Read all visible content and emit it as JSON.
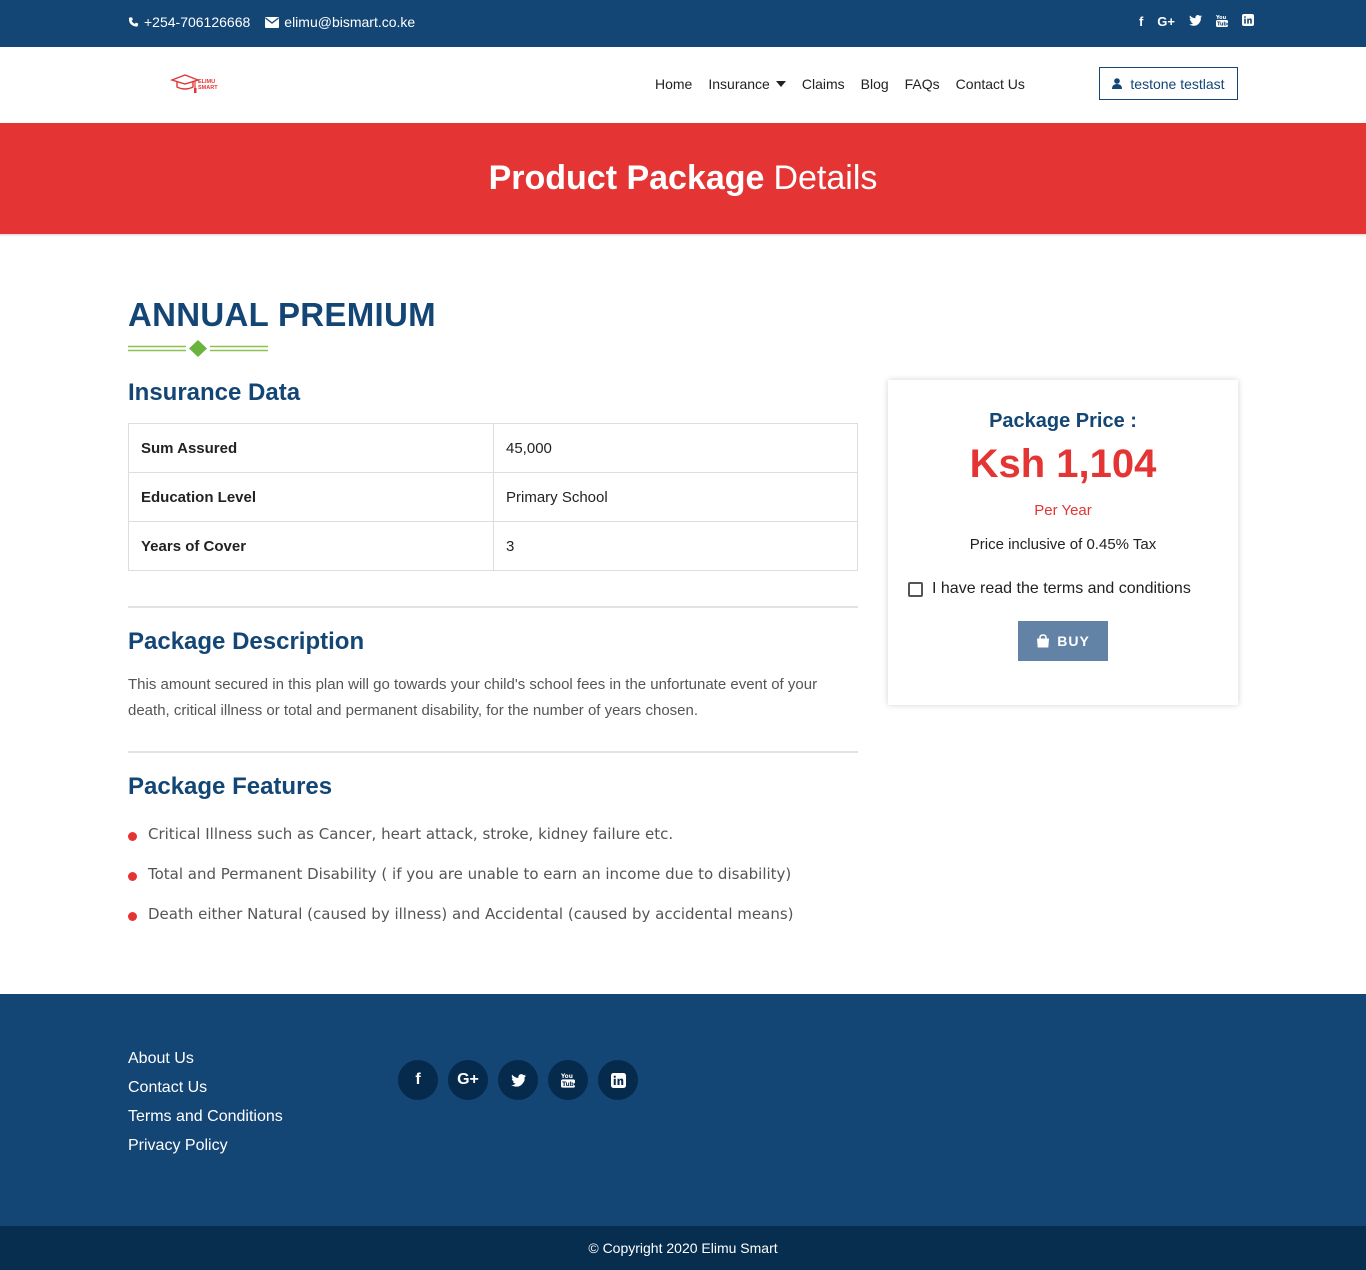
{
  "topbar": {
    "phone": "+254-706126668",
    "email": "elimu@bismart.co.ke",
    "social_icons": [
      "facebook-icon",
      "google-plus-icon",
      "twitter-icon",
      "youtube-icon",
      "linkedin-icon"
    ]
  },
  "nav": {
    "logo_text": "ELIMU SMART",
    "links": [
      "Home",
      "Insurance",
      "Claims",
      "Blog",
      "FAQs",
      "Contact Us"
    ],
    "user_name": "testone testlast"
  },
  "banner": {
    "title_bold": "Product Package",
    "title_rest": "Details"
  },
  "main": {
    "page_title": "ANNUAL PREMIUM",
    "insurance_data_title": "Insurance Data",
    "insurance_rows": [
      {
        "key": "Sum Assured",
        "value": "45,000"
      },
      {
        "key": "Education Level",
        "value": "Primary School"
      },
      {
        "key": "Years of Cover",
        "value": "3"
      }
    ],
    "description_title": "Package Description",
    "description": "This amount secured in this plan will go towards your child's school fees in the unfortunate event of your death, critical illness or total and permanent disability, for the number of years chosen.",
    "features_title": "Package Features",
    "features": [
      "Critical Illness such as Cancer, heart attack, stroke, kidney failure etc.",
      "Total and Permanent Disability ( if you are unable to earn an income due to disability)",
      "Death either Natural (caused by illness) and Accidental (caused by accidental means)"
    ]
  },
  "price_card": {
    "label": "Package Price :",
    "amount": "Ksh 1,104",
    "period": "Per Year",
    "tax_note": "Price inclusive of 0.45% Tax",
    "terms_label": "I have read the terms and conditions",
    "terms_checked": false,
    "buy_label": "BUY"
  },
  "footer": {
    "links": [
      "About Us",
      "Contact Us",
      "Terms and Conditions",
      "Privacy Policy"
    ],
    "social_icons": [
      "facebook-icon",
      "google-plus-icon",
      "twitter-icon",
      "youtube-icon",
      "linkedin-icon"
    ],
    "copyright": "© Copyright 2020 Elimu Smart"
  },
  "colors": {
    "brand_blue": "#134575",
    "accent_red": "#e53434",
    "buy_button": "#6282a6",
    "footer_bottom": "#072e4f"
  }
}
